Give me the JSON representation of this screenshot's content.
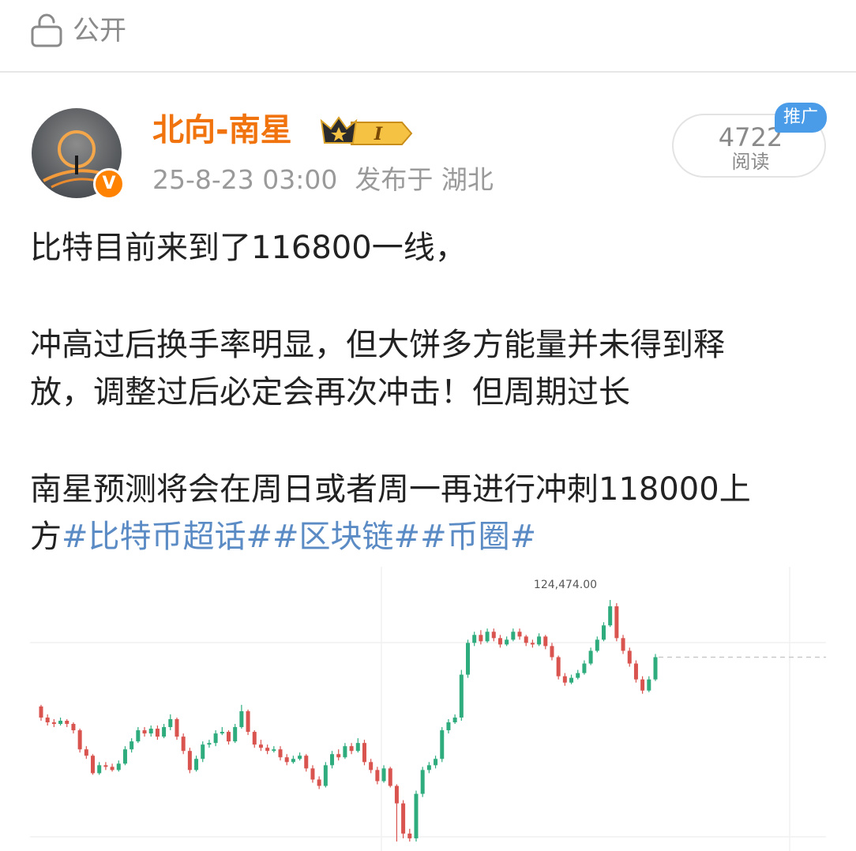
{
  "header": {
    "visibility_label": "公开",
    "visibility_icon": "lock-icon"
  },
  "author": {
    "name": "北向-南星",
    "verified_badge": "V",
    "level_badge": "I",
    "post_time": "25-8-23 03:00",
    "location": "发布于 湖北"
  },
  "stats": {
    "reads_count": "4722",
    "reads_label": "阅读",
    "promo_tag": "推广"
  },
  "post": {
    "line1": "比特目前来到了116800一线，",
    "line2": "冲高过后换手率明显，但大饼多方能量并未得到释",
    "line3": "放，调整过后必定会再次冲击！但周期过长",
    "line4": "南星预测将会在周日或者周一再进行冲刺118000上",
    "line5_prefix": "方",
    "hashtags": [
      "#比特币超话#",
      "#区块链#",
      "#币圈#"
    ]
  },
  "chart_data": {
    "type": "candlestick",
    "peak_label": "124,474.00",
    "up_color": "#2eac7e",
    "down_color": "#d9534f",
    "candles": [
      [
        0.95,
        0.88,
        0.96,
        0.86
      ],
      [
        0.88,
        0.85,
        0.9,
        0.83
      ],
      [
        0.85,
        0.84,
        0.87,
        0.82
      ],
      [
        0.84,
        0.86,
        0.88,
        0.83
      ],
      [
        0.86,
        0.84,
        0.87,
        0.82
      ],
      [
        0.84,
        0.8,
        0.85,
        0.78
      ],
      [
        0.8,
        0.68,
        0.81,
        0.66
      ],
      [
        0.68,
        0.64,
        0.7,
        0.62
      ],
      [
        0.64,
        0.53,
        0.65,
        0.52
      ],
      [
        0.53,
        0.58,
        0.6,
        0.52
      ],
      [
        0.58,
        0.57,
        0.6,
        0.55
      ],
      [
        0.57,
        0.55,
        0.59,
        0.54
      ],
      [
        0.55,
        0.59,
        0.61,
        0.54
      ],
      [
        0.59,
        0.68,
        0.7,
        0.58
      ],
      [
        0.68,
        0.73,
        0.75,
        0.66
      ],
      [
        0.73,
        0.8,
        0.82,
        0.72
      ],
      [
        0.8,
        0.78,
        0.82,
        0.76
      ],
      [
        0.78,
        0.81,
        0.83,
        0.76
      ],
      [
        0.81,
        0.76,
        0.83,
        0.74
      ],
      [
        0.76,
        0.82,
        0.84,
        0.75
      ],
      [
        0.82,
        0.87,
        0.9,
        0.8
      ],
      [
        0.87,
        0.76,
        0.88,
        0.74
      ],
      [
        0.76,
        0.67,
        0.78,
        0.65
      ],
      [
        0.67,
        0.55,
        0.69,
        0.53
      ],
      [
        0.55,
        0.62,
        0.64,
        0.54
      ],
      [
        0.62,
        0.71,
        0.73,
        0.6
      ],
      [
        0.71,
        0.72,
        0.74,
        0.69
      ],
      [
        0.72,
        0.78,
        0.8,
        0.7
      ],
      [
        0.78,
        0.79,
        0.82,
        0.77
      ],
      [
        0.79,
        0.73,
        0.8,
        0.71
      ],
      [
        0.73,
        0.82,
        0.84,
        0.72
      ],
      [
        0.82,
        0.92,
        0.96,
        0.81
      ],
      [
        0.92,
        0.79,
        0.93,
        0.77
      ],
      [
        0.79,
        0.71,
        0.8,
        0.69
      ],
      [
        0.71,
        0.69,
        0.74,
        0.67
      ],
      [
        0.69,
        0.67,
        0.71,
        0.65
      ],
      [
        0.67,
        0.68,
        0.7,
        0.66
      ],
      [
        0.68,
        0.63,
        0.7,
        0.61
      ],
      [
        0.63,
        0.6,
        0.65,
        0.58
      ],
      [
        0.6,
        0.62,
        0.64,
        0.59
      ],
      [
        0.62,
        0.64,
        0.66,
        0.61
      ],
      [
        0.64,
        0.56,
        0.65,
        0.54
      ],
      [
        0.56,
        0.49,
        0.58,
        0.47
      ],
      [
        0.49,
        0.45,
        0.51,
        0.43
      ],
      [
        0.45,
        0.58,
        0.6,
        0.44
      ],
      [
        0.58,
        0.65,
        0.67,
        0.56
      ],
      [
        0.65,
        0.63,
        0.68,
        0.61
      ],
      [
        0.63,
        0.7,
        0.72,
        0.62
      ],
      [
        0.7,
        0.67,
        0.72,
        0.65
      ],
      [
        0.67,
        0.72,
        0.75,
        0.66
      ],
      [
        0.72,
        0.6,
        0.74,
        0.58
      ],
      [
        0.6,
        0.55,
        0.62,
        0.53
      ],
      [
        0.55,
        0.48,
        0.57,
        0.46
      ],
      [
        0.48,
        0.56,
        0.58,
        0.47
      ],
      [
        0.56,
        0.45,
        0.57,
        0.44
      ],
      [
        0.45,
        0.34,
        0.46,
        0.1
      ],
      [
        0.34,
        0.15,
        0.36,
        0.12
      ],
      [
        0.15,
        0.12,
        0.18,
        0.1
      ],
      [
        0.12,
        0.4,
        0.42,
        0.1
      ],
      [
        0.4,
        0.55,
        0.57,
        0.38
      ],
      [
        0.55,
        0.58,
        0.6,
        0.53
      ],
      [
        0.58,
        0.62,
        0.64,
        0.56
      ],
      [
        0.62,
        0.8,
        0.82,
        0.6
      ],
      [
        0.8,
        0.85,
        0.87,
        0.78
      ],
      [
        0.85,
        0.88,
        0.9,
        0.84
      ],
      [
        0.88,
        1.15,
        1.18,
        0.86
      ],
      [
        1.15,
        1.35,
        1.37,
        1.13
      ],
      [
        1.35,
        1.4,
        1.42,
        1.33
      ],
      [
        1.4,
        1.36,
        1.43,
        1.34
      ],
      [
        1.36,
        1.42,
        1.44,
        1.35
      ],
      [
        1.42,
        1.38,
        1.44,
        1.36
      ],
      [
        1.38,
        1.34,
        1.4,
        1.32
      ],
      [
        1.34,
        1.37,
        1.39,
        1.33
      ],
      [
        1.37,
        1.42,
        1.44,
        1.36
      ],
      [
        1.42,
        1.39,
        1.44,
        1.37
      ],
      [
        1.39,
        1.35,
        1.4,
        1.33
      ],
      [
        1.35,
        1.34,
        1.37,
        1.32
      ],
      [
        1.34,
        1.39,
        1.41,
        1.33
      ],
      [
        1.39,
        1.33,
        1.4,
        1.31
      ],
      [
        1.33,
        1.26,
        1.35,
        1.24
      ],
      [
        1.26,
        1.14,
        1.27,
        1.12
      ],
      [
        1.14,
        1.1,
        1.16,
        1.08
      ],
      [
        1.1,
        1.13,
        1.15,
        1.09
      ],
      [
        1.13,
        1.16,
        1.18,
        1.12
      ],
      [
        1.16,
        1.22,
        1.24,
        1.15
      ],
      [
        1.22,
        1.3,
        1.32,
        1.21
      ],
      [
        1.3,
        1.37,
        1.39,
        1.29
      ],
      [
        1.37,
        1.46,
        1.48,
        1.36
      ],
      [
        1.46,
        1.58,
        1.62,
        1.45
      ],
      [
        1.58,
        1.38,
        1.6,
        1.36
      ],
      [
        1.38,
        1.3,
        1.4,
        1.28
      ],
      [
        1.3,
        1.22,
        1.32,
        1.2
      ],
      [
        1.22,
        1.12,
        1.24,
        1.1
      ],
      [
        1.12,
        1.05,
        1.14,
        1.03
      ],
      [
        1.05,
        1.12,
        1.14,
        1.04
      ],
      [
        1.12,
        1.26,
        1.28,
        1.11
      ]
    ]
  }
}
